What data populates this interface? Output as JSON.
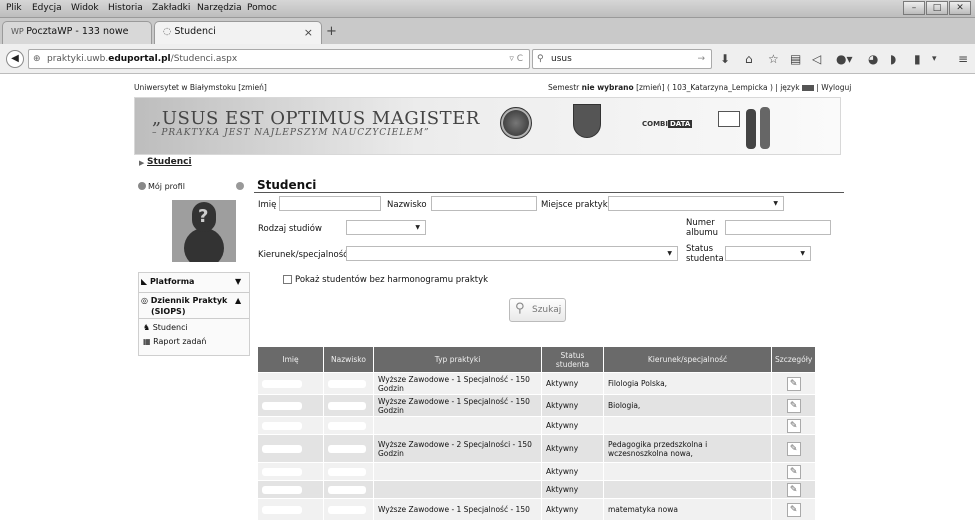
{
  "menu": [
    "Plik",
    "Edycja",
    "Widok",
    "Historia",
    "Zakładki",
    "Narzędzia",
    "Pomoc"
  ],
  "tabs": [
    {
      "label": "PocztaWP - 133 nowe"
    },
    {
      "label": "Studenci"
    }
  ],
  "url": {
    "prefix": "praktyki.uwb.",
    "domain": "eduportal.pl",
    "path": "/Studenci.aspx"
  },
  "search_value": "usus",
  "header": {
    "university": "Uniwersytet w Białymstoku [zmień]",
    "semester_pre": "Semestr",
    "semester_bold": "nie wybrano",
    "semester_post": "[zmień] ( 103_Katarzyna_Lempicka ) | język",
    "logout": "| Wyloguj"
  },
  "banner": {
    "motto_line1": "„USUS EST OPTIMUS MAGISTER",
    "motto_line2": "– PRAKTYKA JEST NAJLEPSZYM NAUCZYCIELEM”",
    "partner_pre": "COMBI",
    "partner_post": "DATA"
  },
  "breadcrumb": "Studenci",
  "sidebar": {
    "profile": "Mój profil",
    "platform": "Platforma",
    "journal": "Dziennik Praktyk",
    "journal_sub": "(SIOPS)",
    "items": [
      "Studenci",
      "Raport zadań"
    ]
  },
  "section_title": "Studenci",
  "filters": {
    "first_name": "Imię",
    "last_name": "Nazwisko",
    "location": "Miejsce praktyki",
    "study_type": "Rodzaj studiów",
    "album_line1": "Numer",
    "album_line2": "albumu",
    "major": "Kierunek/specjalność",
    "status_line1": "Status",
    "status_line2": "studenta",
    "no_schedule": "Pokaż studentów bez harmonogramu praktyk",
    "search_button": "Szukaj"
  },
  "table": {
    "headers": [
      "Imię",
      "Nazwisko",
      "Typ praktyki",
      "Status studenta",
      "Kierunek/specjalność",
      "Szczegóły"
    ],
    "rows": [
      {
        "type": "Wyższe Zawodowe - 1 Specjalność - 150 Godzin",
        "status": "Aktywny",
        "major": "Filologia Polska,"
      },
      {
        "type": "Wyższe Zawodowe - 1 Specjalność - 150 Godzin",
        "status": "Aktywny",
        "major": "Biologia,"
      },
      {
        "type": "",
        "status": "Aktywny",
        "major": ""
      },
      {
        "type": "Wyższe Zawodowe - 2 Specjalności - 150 Godzin",
        "status": "Aktywny",
        "major": "Pedagogika przedszkolna i wczesnoszkolna nowa,"
      },
      {
        "type": "",
        "status": "Aktywny",
        "major": ""
      },
      {
        "type": "",
        "status": "Aktywny",
        "major": ""
      },
      {
        "type": "Wyższe Zawodowe - 1 Specjalność - 150",
        "status": "Aktywny",
        "major": "matematyka nowa"
      }
    ]
  }
}
